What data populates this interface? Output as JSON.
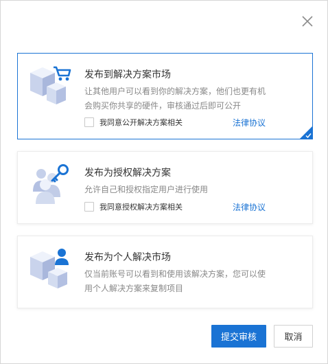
{
  "dialog": {
    "close_icon": "close-icon"
  },
  "options": [
    {
      "title": "发布到解决方案市场",
      "desc_line1": "让其他用户可以看到你的解决方案，他们也更有机",
      "desc_line2": "会购买你共享的硬件，审核通过后即可公开",
      "agree": "我同意公开解决方案相关",
      "link": "法律协议",
      "icon": "market-cubes-cart-icon",
      "selected": true
    },
    {
      "title": "发布为授权解决方案",
      "desc_line1": "允许自己和授权指定用户进行使用",
      "agree": "我同意授权解决方案相关",
      "link": "法律协议",
      "icon": "users-key-icon",
      "selected": false
    },
    {
      "title": "发布为个人解决市场",
      "desc_line1": "仅当前账号可以看到和使用该解决方案，您可以使",
      "desc_line2": "用个人解决方案来复制项目",
      "icon": "cubes-user-icon",
      "selected": false
    }
  ],
  "footer": {
    "submit": "提交审核",
    "cancel": "取消"
  },
  "colors": {
    "accent": "#1a73d4",
    "icon_light": "#dbe3f4",
    "icon_mid": "#aebbdb",
    "icon_dark": "#8a9bc8"
  }
}
